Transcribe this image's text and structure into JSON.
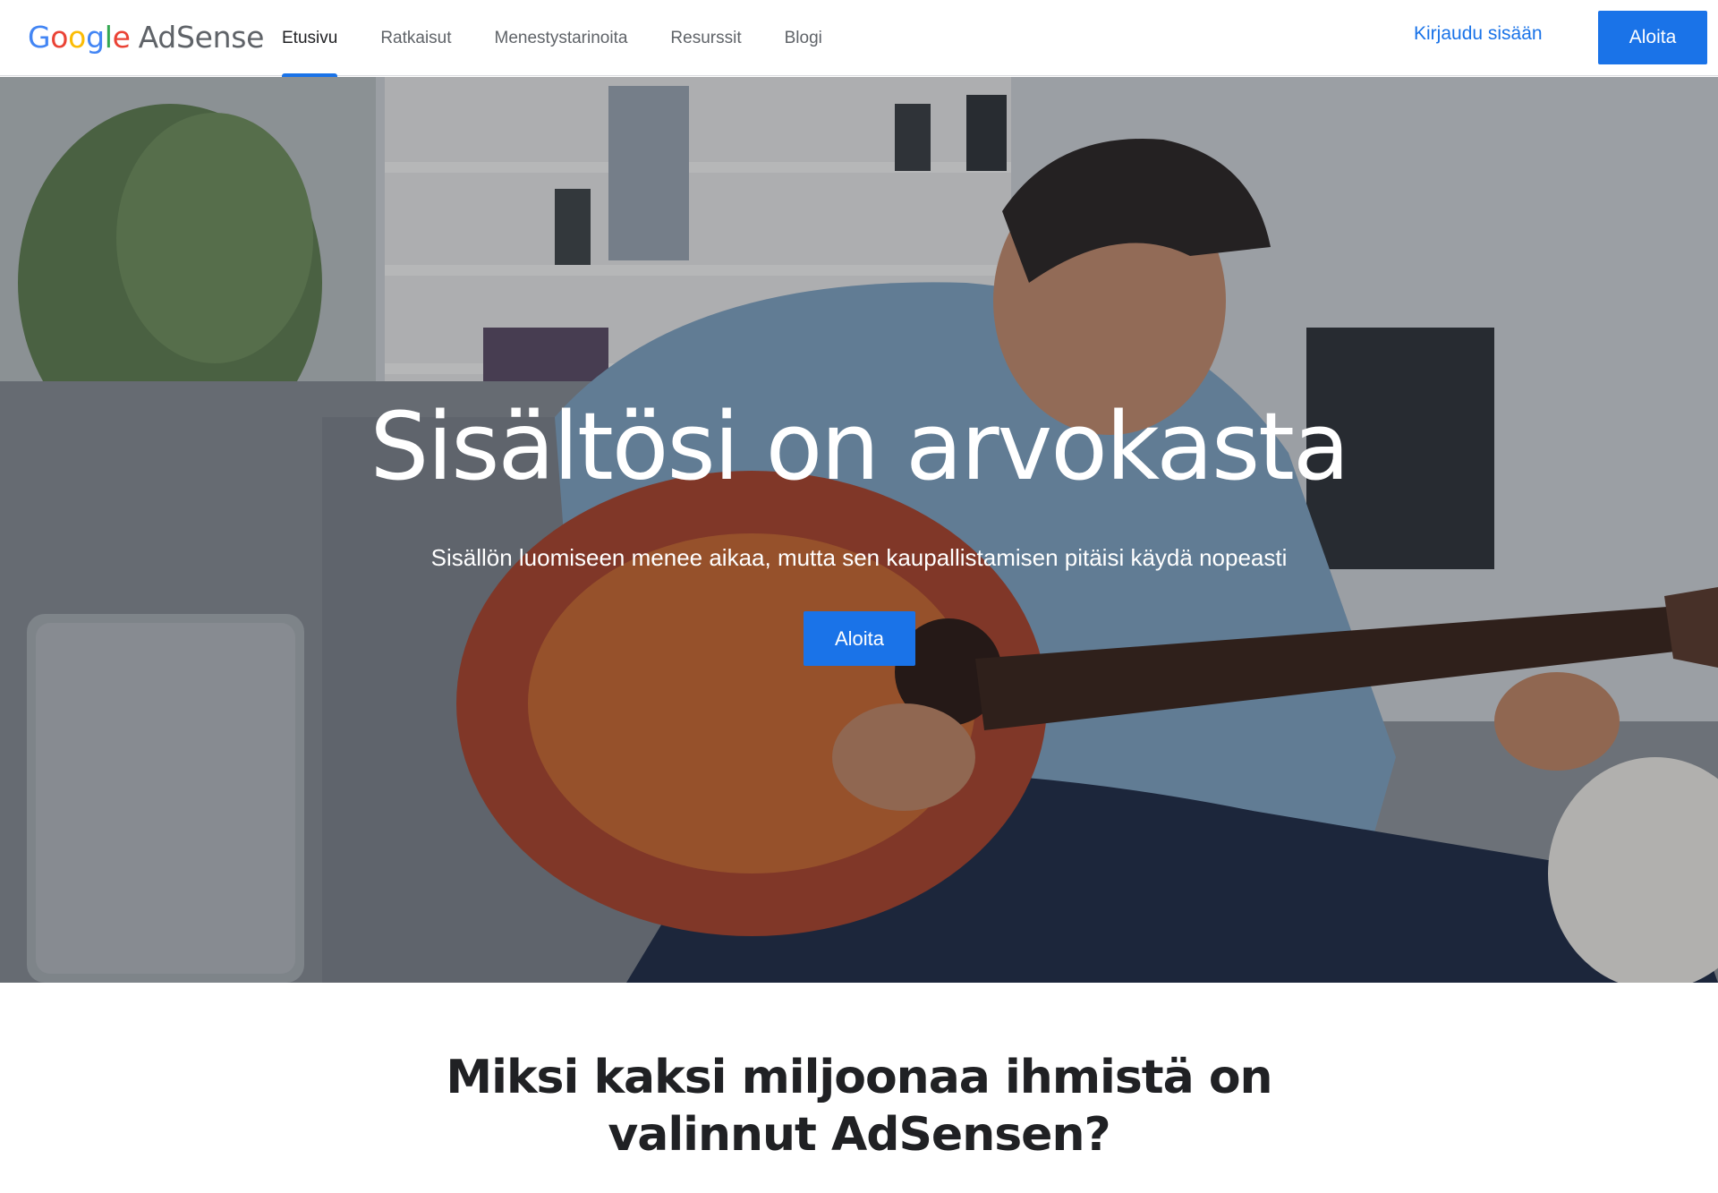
{
  "header": {
    "logo": {
      "google": [
        "G",
        "o",
        "o",
        "g",
        "l",
        "e"
      ],
      "product": "AdSense"
    },
    "nav": [
      {
        "label": "Etusivu",
        "active": true
      },
      {
        "label": "Ratkaisut",
        "active": false
      },
      {
        "label": "Menestystarinoita",
        "active": false
      },
      {
        "label": "Resurssit",
        "active": false
      },
      {
        "label": "Blogi",
        "active": false
      }
    ],
    "signin_label": "Kirjaudu sisään",
    "cta_label": "Aloita"
  },
  "hero": {
    "title": "Sisältösi on arvokasta",
    "subtitle": "Sisällön luomiseen menee aikaa, mutta sen kaupallistamisen pitäisi käydä nopeasti",
    "cta_label": "Aloita"
  },
  "section": {
    "title_line1": "Miksi kaksi miljoonaa ihmistä on",
    "title_line2": "valinnut AdSensen?"
  },
  "colors": {
    "accent": "#1a73e8",
    "google_blue": "#4285f4",
    "google_red": "#ea4335",
    "google_yellow": "#fbbc05",
    "google_green": "#34a853"
  }
}
